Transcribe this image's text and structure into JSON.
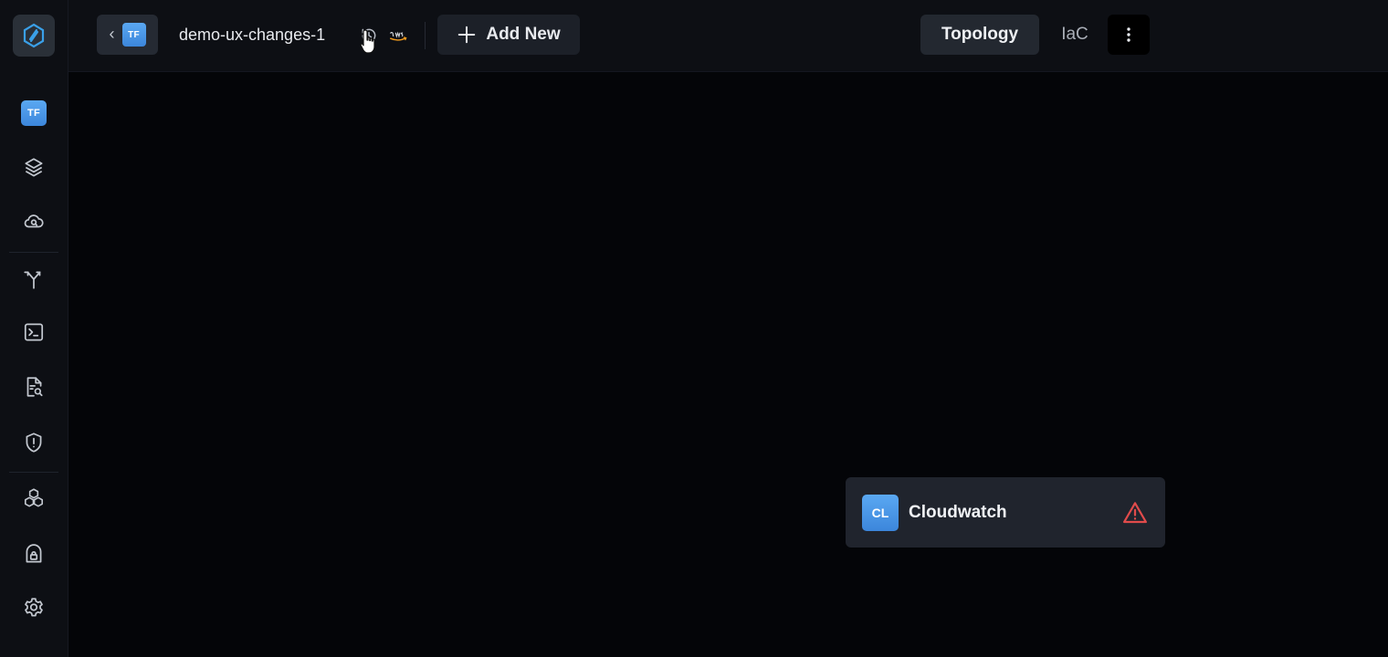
{
  "sidebar": {
    "logo": "stackgen-logo-icon",
    "items": [
      {
        "name": "terraform-project",
        "badge": "TF"
      },
      {
        "name": "layers-icon"
      },
      {
        "name": "cloud-search-icon"
      },
      {
        "name": "merge-icon"
      },
      {
        "name": "terminal-icon"
      },
      {
        "name": "document-search-icon"
      },
      {
        "name": "shield-alert-icon"
      },
      {
        "name": "modules-icon"
      },
      {
        "name": "cloud-lock-icon"
      },
      {
        "name": "gear-icon"
      }
    ]
  },
  "header": {
    "back_badge": "TF",
    "project_name": "demo-ux-changes-1",
    "add_new_label": "Add New",
    "tabs": [
      {
        "label": "Topology",
        "active": true
      },
      {
        "label": "IaC",
        "active": false
      }
    ]
  },
  "canvas": {
    "node": {
      "badge": "CL",
      "title": "Cloudwatch",
      "status": "warning"
    }
  },
  "colors": {
    "background": "#040508",
    "panel": "#0d0f14",
    "badge": "#4a96e6",
    "warning": "#e14b4b"
  }
}
